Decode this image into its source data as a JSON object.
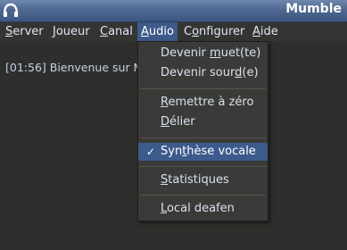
{
  "window": {
    "title": "Mumble",
    "app_icon": "mumble-logo-icon"
  },
  "menubar": {
    "items": [
      {
        "label_prefix": "",
        "label_mnemonic": "S",
        "label_suffix": "erver"
      },
      {
        "label_prefix": "",
        "label_mnemonic": "J",
        "label_suffix": "oueur"
      },
      {
        "label_prefix": "",
        "label_mnemonic": "C",
        "label_suffix": "anal"
      },
      {
        "label_prefix": "",
        "label_mnemonic": "A",
        "label_suffix": "udio"
      },
      {
        "label_prefix": "C",
        "label_mnemonic": "o",
        "label_suffix": "nfigurer"
      },
      {
        "label_prefix": "",
        "label_mnemonic": "A",
        "label_suffix": "ide"
      }
    ],
    "active_index": 3
  },
  "log": {
    "line": "[01:56] Bienvenue sur M"
  },
  "audio_menu": {
    "items": [
      {
        "pre": "Devenir ",
        "mn": "m",
        "post": "uet(te)"
      },
      {
        "pre": "Devenir sour",
        "mn": "d",
        "post": "(e)"
      },
      {
        "pre": "",
        "mn": "R",
        "post": "emettre à zéro"
      },
      {
        "pre": "",
        "mn": "D",
        "post": "élier"
      },
      {
        "pre": "Syn",
        "mn": "t",
        "post": "hèse vocale",
        "checked": true
      },
      {
        "pre": "",
        "mn": "S",
        "post": "tatistiques"
      },
      {
        "pre": "",
        "mn": "L",
        "post": "ocal deafen"
      }
    ],
    "check_glyph": "✓"
  }
}
